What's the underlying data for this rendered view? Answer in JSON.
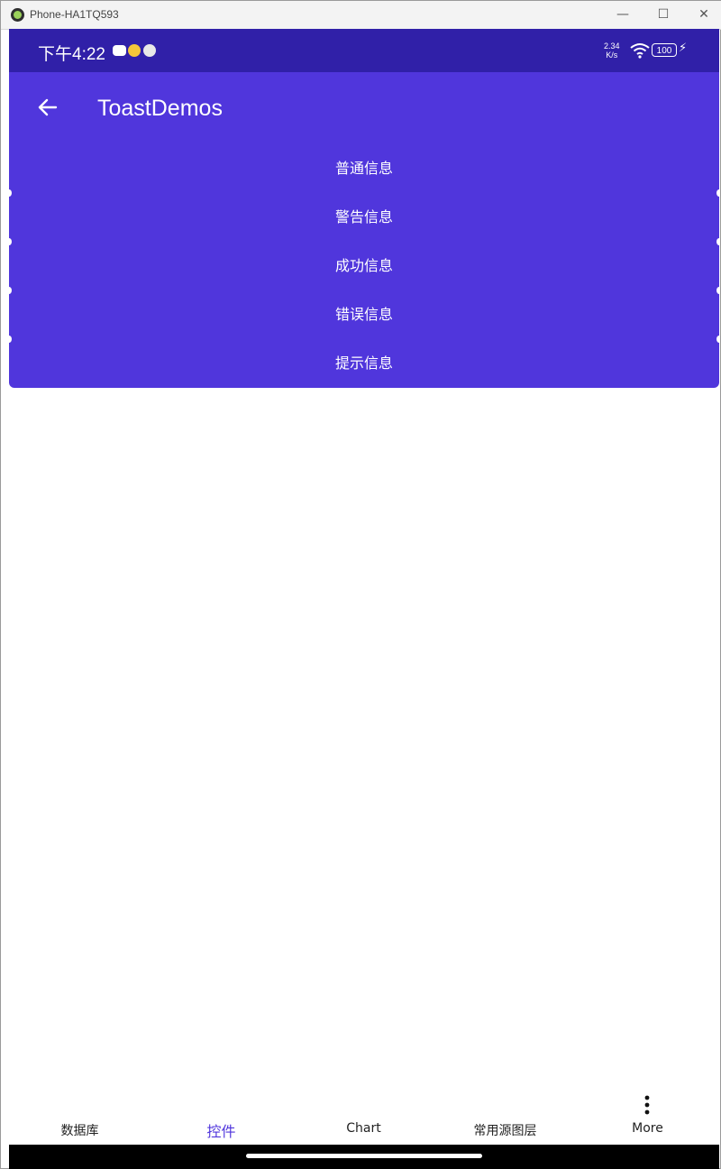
{
  "window": {
    "title": "Phone-HA1TQ593",
    "minimize": "—",
    "maximize": "☐",
    "close": "✕"
  },
  "statusbar": {
    "time": "下午4:22",
    "speed_value": "2.34",
    "speed_unit": "K/s",
    "battery": "100"
  },
  "appbar": {
    "title": "ToastDemos"
  },
  "menu": {
    "items": [
      {
        "label": "普通信息"
      },
      {
        "label": "警告信息"
      },
      {
        "label": "成功信息"
      },
      {
        "label": "错误信息"
      },
      {
        "label": "提示信息"
      }
    ]
  },
  "bottomnav": {
    "items": [
      {
        "label": "数据库"
      },
      {
        "label": "控件"
      },
      {
        "label": "Chart"
      },
      {
        "label": "常用源图层"
      },
      {
        "label": "More"
      }
    ],
    "active_index": 1
  },
  "colors": {
    "statusbar": "#3020a8",
    "primary": "#5036dc",
    "active_tab": "#5036dc"
  }
}
